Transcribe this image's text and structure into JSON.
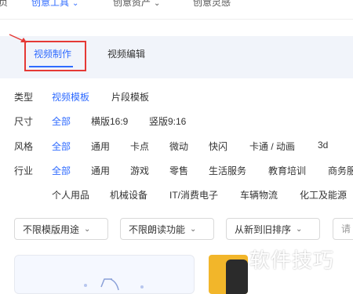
{
  "topnav": {
    "items": [
      {
        "label": "页",
        "active": false
      },
      {
        "label": "创意工具",
        "active": true,
        "chevron": "chevron-down-icon"
      },
      {
        "label": "创意资产",
        "active": false,
        "chevron": "chevron-down-icon"
      },
      {
        "label": "创意灵感",
        "active": false
      }
    ]
  },
  "tabs": [
    {
      "label": "视频制作",
      "active": true
    },
    {
      "label": "视频编辑",
      "active": false
    }
  ],
  "filters": {
    "type": {
      "label": "类型",
      "options": [
        "视频模板",
        "片段模板"
      ]
    },
    "size": {
      "label": "尺寸",
      "options": [
        "全部",
        "横版16:9",
        "竖版9:16"
      ]
    },
    "style": {
      "label": "风格",
      "options": [
        "全部",
        "通用",
        "卡点",
        "微动",
        "快闪",
        "卡通 / 动画",
        "3d"
      ]
    },
    "industry": {
      "label": "行业",
      "options_row1": [
        "全部",
        "通用",
        "游戏",
        "零售",
        "生活服务",
        "教育培训",
        "商务服"
      ],
      "options_row2": [
        "个人用品",
        "机械设备",
        "IT/消费电子",
        "车辆物流",
        "化工及能源"
      ]
    }
  },
  "dropdowns": [
    {
      "label": "不限模版用途"
    },
    {
      "label": "不限朗读功能"
    },
    {
      "label": "从新到旧排序"
    }
  ],
  "search": {
    "placeholder": "请"
  },
  "watermark": "软件技巧",
  "colors": {
    "accent": "#2f6bff",
    "highlight_box": "#e53935",
    "tab_bg": "#f1f4fa"
  }
}
